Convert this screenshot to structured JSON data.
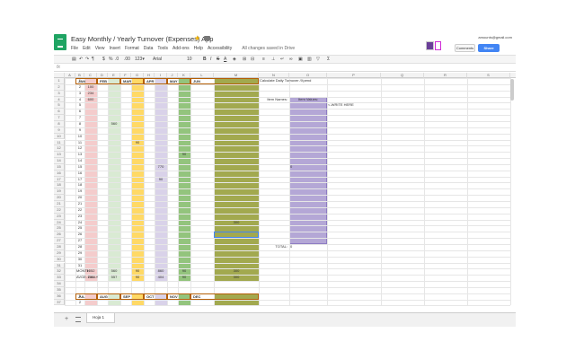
{
  "app": {
    "doc_title": "Easy Monthly / Yearly Turnover (Expenses) App",
    "menus": [
      "File",
      "Edit",
      "View",
      "Insert",
      "Format",
      "Data",
      "Tools",
      "Add-ons",
      "Help",
      "Accessibility"
    ],
    "saved_status": "All changes saved in Drive",
    "user_email": "amounts@gmail.com",
    "comments_label": "Comments",
    "share_label": "Share",
    "fx_label": "fx"
  },
  "toolbar": {
    "font_name": "Arial",
    "font_size": "10",
    "icons": [
      "print-icon",
      "undo-icon",
      "redo-icon",
      "paint-format-icon",
      "currency-icon",
      "percent-icon",
      "decimal-icon",
      "bold-icon",
      "italic-icon",
      "strikethrough-icon",
      "text-color-icon",
      "fill-color-icon",
      "borders-icon",
      "merge-icon",
      "align-icon",
      "valign-icon",
      "wrap-icon",
      "link-icon",
      "comment-icon",
      "chart-icon",
      "filter-icon",
      "functions-icon"
    ]
  },
  "columns": [
    "A",
    "B",
    "C",
    "D",
    "E",
    "F",
    "G",
    "H",
    "I",
    "J",
    "K",
    "L",
    "M",
    "N",
    "O",
    "P",
    "Q",
    "R",
    "S",
    "T",
    "U",
    "V"
  ],
  "months_top": {
    "jan": "JAN",
    "feb": "FEB",
    "mar": "MAR",
    "apr": "APR",
    "may": "MAY",
    "jun": "JUN"
  },
  "months_bottom": {
    "jul": "JUL",
    "aug": "AUG",
    "sep": "SEP",
    "oct": "OCT",
    "nov": "NOV",
    "dec": "DEC"
  },
  "colors": {
    "jan": "#f4cccc",
    "feb": "#d9ead3",
    "mar": "#ffd966",
    "apr": "#d9d2e9",
    "may": "#93c47d",
    "jun": "#a2a94f",
    "item_values": "#b4a7d6",
    "logo": "#1fa463",
    "share": "#4285f4"
  },
  "day_rows": [
    "1",
    "2",
    "3",
    "4",
    "5",
    "6",
    "7",
    "8",
    "9",
    "10",
    "11",
    "12",
    "13",
    "14",
    "15",
    "16",
    "17",
    "18",
    "19",
    "20",
    "21",
    "22",
    "23",
    "24",
    "25",
    "26",
    "27",
    "28",
    "29",
    "30",
    "31"
  ],
  "row_numbers": [
    "1",
    "2",
    "3",
    "4",
    "5",
    "6",
    "7",
    "8",
    "9",
    "10",
    "11",
    "12",
    "13",
    "14",
    "15",
    "16",
    "17",
    "18",
    "19",
    "20",
    "21",
    "22",
    "23",
    "24",
    "25",
    "26",
    "27",
    "28",
    "29",
    "30",
    "31",
    "32",
    "33",
    "34",
    "35",
    "36",
    "37"
  ],
  "values": {
    "jan_d2": "100",
    "jan_d3": "234",
    "jan_d4": "600",
    "feb_d8": "560",
    "mar_d11": "90",
    "may_d13": "90",
    "apr_d15": "770",
    "apr_d17": "90",
    "jun_d24": "300"
  },
  "summary": {
    "month_label": "MONTH",
    "daily_label": "AVGE. DAILY",
    "jan_month": "1052",
    "jan_daily": "234",
    "feb_month": "560",
    "feb_daily": "557",
    "mar_month": "90",
    "mar_daily": "90",
    "apr_month": "860",
    "apr_daily": "404",
    "may_month": "90",
    "may_daily": "90",
    "jun_month": "300",
    "jun_daily": "300"
  },
  "calc_panel": {
    "title": "Calculate Daily Turnover /Xpend",
    "item_names_label": "Item Names:",
    "item_values_label": "Item Values:",
    "write_here": "<-WRITE HERE",
    "mid_value": "0",
    "total_label": "TOTAL:",
    "total_value": "0"
  },
  "bottom_rows": {
    "r36": "1",
    "r37": "2"
  },
  "sheet_tab": "Hoja 1"
}
